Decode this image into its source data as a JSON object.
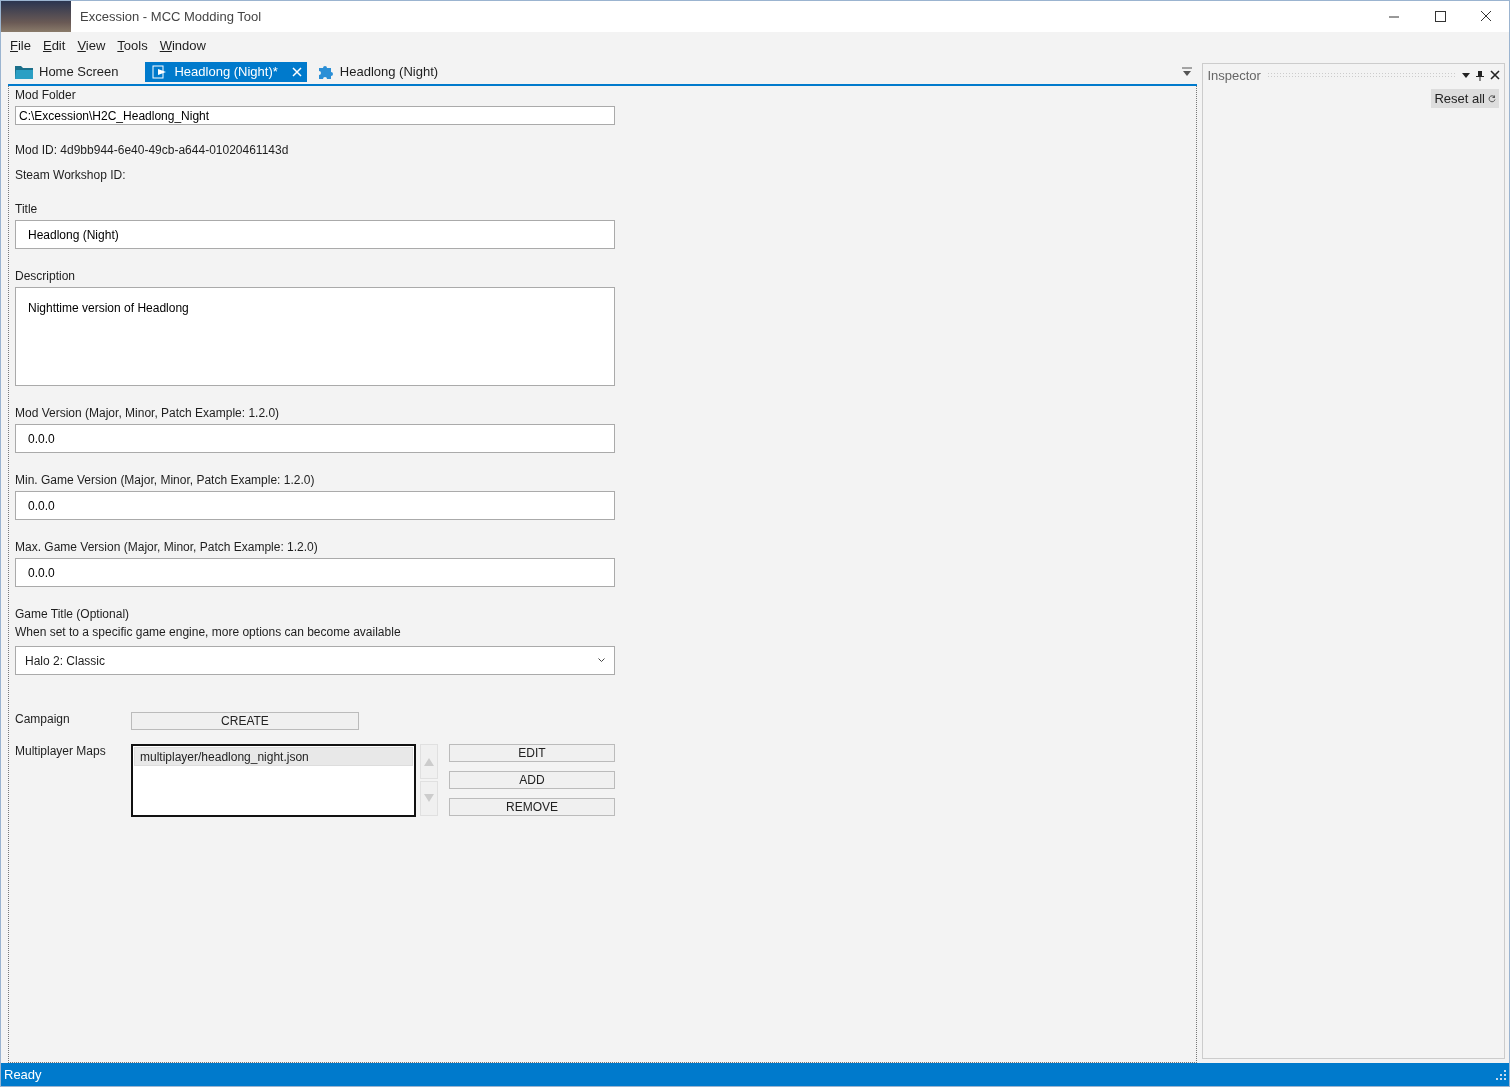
{
  "window": {
    "title": "Excession - MCC Modding Tool"
  },
  "menu": [
    "File",
    "Edit",
    "View",
    "Tools",
    "Window"
  ],
  "tabs": [
    {
      "label": "Home Screen",
      "kind": "folder",
      "selected": false,
      "modified": false
    },
    {
      "label": "Headlong (Night)*",
      "kind": "mod",
      "selected": true,
      "modified": true
    },
    {
      "label": "Headlong (Night)",
      "kind": "puzzle",
      "selected": false,
      "modified": false
    }
  ],
  "form": {
    "fields": [
      {
        "kind": "path",
        "label": "Mod Folder",
        "value": "C:\\Excession\\H2C_Headlong_Night"
      },
      {
        "kind": "info",
        "text": "Mod ID: 4d9bb944-6e40-49cb-a644-01020461143d"
      },
      {
        "kind": "info",
        "text": "Steam Workshop ID:"
      },
      {
        "kind": "text",
        "label": "Title",
        "value": "Headlong (Night)"
      },
      {
        "kind": "textarea",
        "label": "Description",
        "value": "Nighttime version of Headlong"
      },
      {
        "kind": "text",
        "label": "Mod Version (Major, Minor, Patch Example: 1.2.0)",
        "value": "0.0.0"
      },
      {
        "kind": "text",
        "label": "Min. Game Version (Major, Minor, Patch Example: 1.2.0)",
        "value": "0.0.0"
      },
      {
        "kind": "text",
        "label": "Max. Game Version (Major, Minor, Patch Example: 1.2.0)",
        "value": "0.0.0"
      },
      {
        "kind": "dropdown",
        "label": "Game Title (Optional)",
        "hint": "When set to a specific game engine, more options can become available",
        "value": "Halo 2: Classic"
      }
    ],
    "campaign": {
      "label": "Campaign",
      "button": "CREATE"
    },
    "multiplayer": {
      "label": "Multiplayer Maps",
      "items": [
        {
          "text": "multiplayer/headlong_night.json",
          "selected": true
        }
      ],
      "buttons": [
        "EDIT",
        "ADD",
        "REMOVE"
      ]
    }
  },
  "inspector": {
    "title": "Inspector",
    "reset": "Reset all"
  },
  "status_bar": "Ready"
}
